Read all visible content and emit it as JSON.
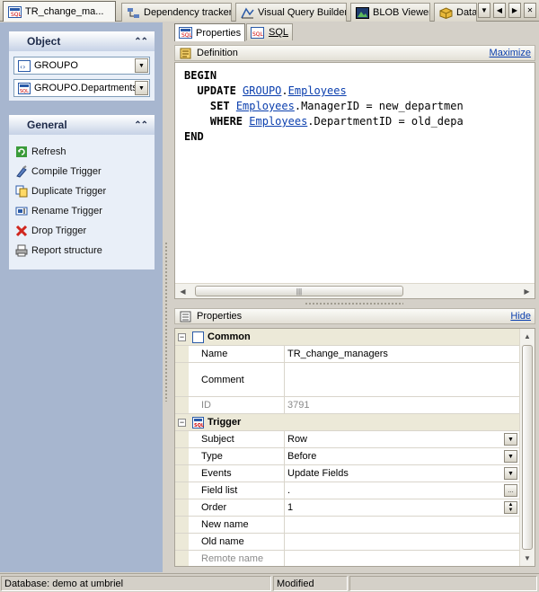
{
  "doc_tabs": [
    {
      "label": "TR_change_ma...",
      "icon": "trigger-icon"
    },
    {
      "label": "Dependency tracker",
      "icon": "dependency-icon"
    },
    {
      "label": "Visual Query Builder",
      "icon": "query-builder-icon"
    },
    {
      "label": "BLOB Viewer",
      "icon": "blob-icon"
    },
    {
      "label": "Data",
      "icon": "data-icon"
    }
  ],
  "nav_buttons": [
    "▼",
    "◀",
    "▶",
    "✕"
  ],
  "object_panel": {
    "title": "Object",
    "collapse": "⌃⌃",
    "database_combo": "GROUPO",
    "table_combo": "GROUPO.Departments"
  },
  "general_panel": {
    "title": "General",
    "collapse": "⌃⌃",
    "items": [
      {
        "label": "Refresh",
        "icon": "refresh-icon"
      },
      {
        "label": "Compile Trigger",
        "icon": "compile-icon"
      },
      {
        "label": "Duplicate Trigger",
        "icon": "duplicate-icon"
      },
      {
        "label": "Rename Trigger",
        "icon": "rename-icon"
      },
      {
        "label": "Drop Trigger",
        "icon": "drop-icon"
      },
      {
        "label": "Report structure",
        "icon": "report-icon"
      }
    ]
  },
  "sub_tabs": [
    {
      "label": "Properties",
      "icon": "trigger-icon"
    },
    {
      "label": "SQL",
      "icon": "sql-icon"
    }
  ],
  "definition": {
    "title": "Definition",
    "action": "Maximize",
    "code": {
      "l1_kw": "BEGIN",
      "l2_kw": "UPDATE",
      "l2_schema": "GROUPO",
      "l2_dot": ".",
      "l2_table": "Employees",
      "l3_kw": "SET",
      "l3_table": "Employees",
      "l3_rest": ".ManagerID = new_departmen",
      "l4_kw": "WHERE",
      "l4_table": "Employees",
      "l4_rest": ".DepartmentID = old_depa",
      "l5_kw": "END"
    }
  },
  "properties": {
    "title": "Properties",
    "action": "Hide",
    "common": {
      "label": "Common",
      "toggle": "−",
      "name_label": "Name",
      "name_value": "TR_change_managers",
      "comment_label": "Comment",
      "comment_value": "",
      "id_label": "ID",
      "id_value": "3791"
    },
    "trigger": {
      "label": "Trigger",
      "toggle": "−",
      "subject_label": "Subject",
      "subject_value": "Row",
      "type_label": "Type",
      "type_value": "Before",
      "events_label": "Events",
      "events_value": "Update Fields",
      "fieldlist_label": "Field list",
      "fieldlist_value": ".",
      "order_label": "Order",
      "order_value": "1",
      "newname_label": "New name",
      "newname_value": "",
      "oldname_label": "Old name",
      "oldname_value": "",
      "remotename_label": "Remote name",
      "remotename_value": ""
    }
  },
  "status": {
    "database": "Database: demo at umbriel",
    "state": "Modified",
    "extra": ""
  },
  "colors": {
    "left_panel": "#a7b6cf",
    "link": "#0b3fae",
    "chrome": "#d4d0c8"
  }
}
